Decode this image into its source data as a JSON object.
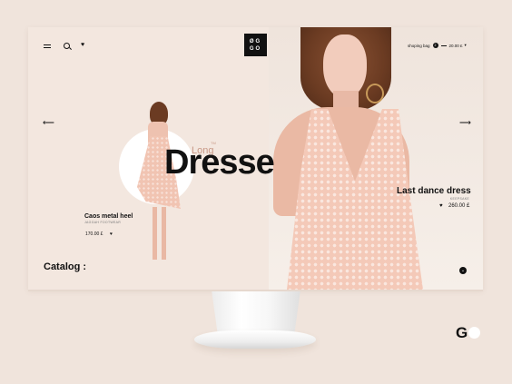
{
  "header": {
    "logo_line1": "ØG",
    "logo_line2": "GO",
    "cart_label": "shoping bag",
    "cart_count": "2",
    "cart_total": "20.00 £"
  },
  "hero": {
    "small_word": "Long",
    "trademark": "TM",
    "big_word": "Dresse"
  },
  "products": [
    {
      "name": "Caos metal heel",
      "sub": "JAGGAH FOOTWEAR",
      "price": "170.00 £"
    },
    {
      "name": "Last dance dress",
      "sub": "KEEPSAKE",
      "price": "260.00 £"
    }
  ],
  "footer": {
    "catalog_label": "Catalog :"
  },
  "brand": {
    "mark": "G"
  },
  "icons": {
    "menu": "hamburger-icon",
    "search": "search-icon",
    "favorites": "heart-icon",
    "prev": "arrow-left-icon",
    "next": "arrow-right-icon",
    "scroll": "scroll-down-icon"
  },
  "colors": {
    "background": "#f0e4dc",
    "screen": "#f3e7df",
    "accent": "#c99a88",
    "text": "#111111"
  }
}
